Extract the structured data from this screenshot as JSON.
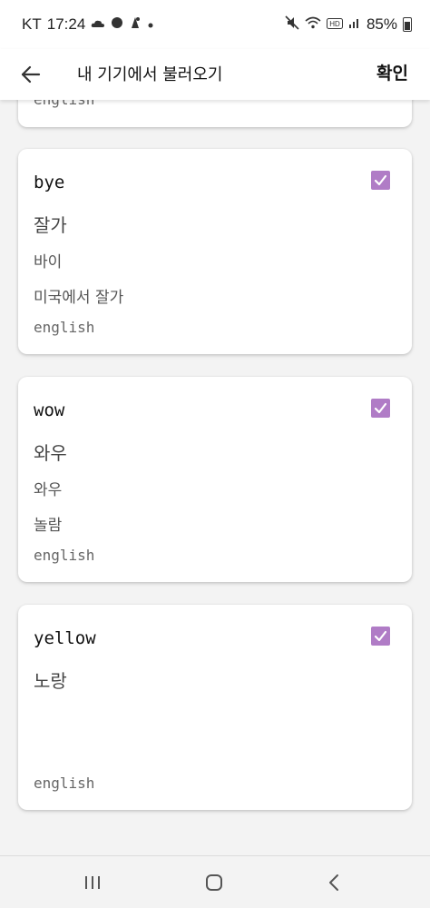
{
  "status_bar": {
    "carrier": "KT",
    "time": "17:24",
    "battery": "85%",
    "icons_left": [
      "weather-icon",
      "chat-icon",
      "notification-icon",
      "dot-icon"
    ],
    "icons_right": [
      "mute-icon",
      "wifi-icon",
      "hd-icon",
      "signal-icon",
      "battery-icon"
    ]
  },
  "app_bar": {
    "title": "내 기기에서 불러오기",
    "confirm_label": "확인",
    "back_icon": "arrow-left-icon"
  },
  "cards": [
    {
      "word": "",
      "meaning": "",
      "line1": "",
      "line2": "",
      "lang": "english",
      "checked": true
    },
    {
      "word": "bye",
      "meaning": "잘가",
      "line1": "바이",
      "line2": "미국에서 잘가",
      "lang": "english",
      "checked": true
    },
    {
      "word": "wow",
      "meaning": "와우",
      "line1": "와우",
      "line2": "놀람",
      "lang": "english",
      "checked": true
    },
    {
      "word": "yellow",
      "meaning": "노랑",
      "line1": "",
      "line2": "",
      "lang": "english",
      "checked": true
    }
  ],
  "colors": {
    "checkbox": "#b07cc6",
    "background": "#f3f3f3",
    "card": "#ffffff"
  },
  "nav_bar": {
    "icons": [
      "recent-apps-icon",
      "home-icon",
      "back-nav-icon"
    ]
  }
}
